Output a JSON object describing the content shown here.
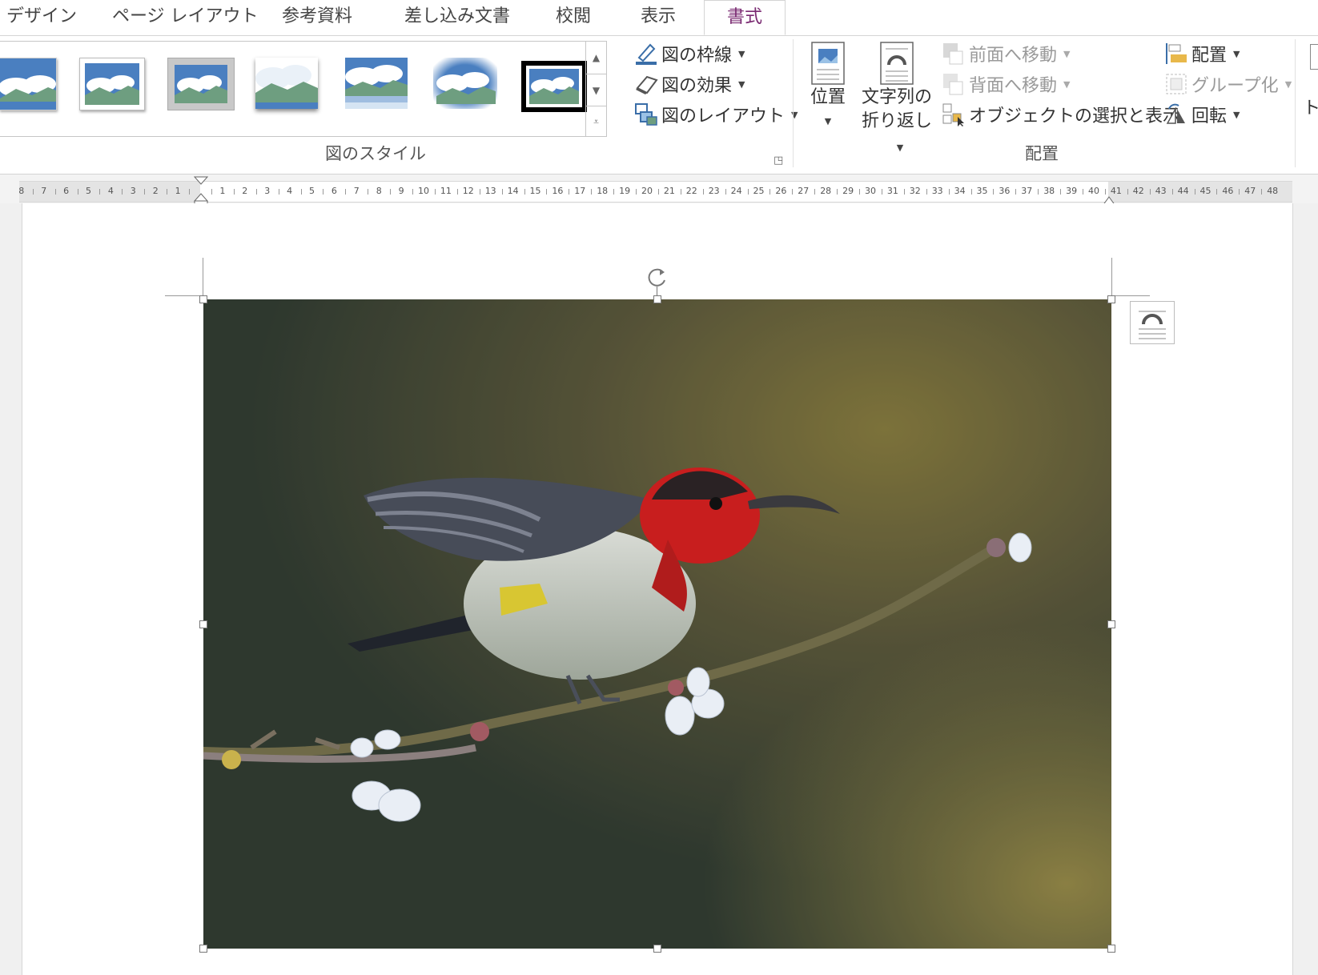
{
  "tabs": [
    {
      "label": "デザイン",
      "active": false
    },
    {
      "label": "ページ レイアウト",
      "active": false
    },
    {
      "label": "参考資料",
      "active": false
    },
    {
      "label": "差し込み文書",
      "active": false
    },
    {
      "label": "校閲",
      "active": false
    },
    {
      "label": "表示",
      "active": false
    },
    {
      "label": "書式",
      "active": true
    }
  ],
  "picture_styles": {
    "group_label": "図のスタイル",
    "border_label": "図の枠線",
    "effects_label": "図の効果",
    "layout_label": "図のレイアウト"
  },
  "arrange": {
    "group_label": "配置",
    "position_label": "位置",
    "wrap_text_line1": "文字列の",
    "wrap_text_line2": "折り返し",
    "bring_forward_label": "前面へ移動",
    "send_backward_label": "背面へ移動",
    "selection_pane_label": "オブジェクトの選択と表示",
    "align_label": "配置",
    "group_obj_label": "グループ化",
    "rotate_label": "回転"
  },
  "cut_off_label": "ト",
  "ruler": {
    "left_ticks": [
      "8",
      "7",
      "6",
      "5",
      "4",
      "3",
      "2",
      "1"
    ],
    "right_ticks": [
      "1",
      "2",
      "3",
      "4",
      "5",
      "6",
      "7",
      "8",
      "9",
      "10",
      "11",
      "12",
      "13",
      "14",
      "15",
      "16",
      "17",
      "18",
      "19",
      "20",
      "21",
      "22",
      "23",
      "24",
      "25",
      "26",
      "27",
      "28",
      "29",
      "30",
      "31",
      "32",
      "33",
      "34",
      "35",
      "36",
      "37",
      "38",
      "39",
      "40",
      "41",
      "42",
      "43",
      "44",
      "45",
      "46",
      "47",
      "48"
    ]
  },
  "icons": {
    "border": "pen-icon",
    "effects": "eraser-icon",
    "layout": "smartart-icon",
    "position": "position-icon",
    "wrap": "wrap-text-icon",
    "rotate": "rotate-icon",
    "rotate_handle": "rotate-handle-icon",
    "layout_options": "layout-options-icon"
  },
  "colors": {
    "active_tab": "#7a2a72",
    "thumb_blue": "#4a7fc0",
    "thumb_green": "#6e9e80"
  }
}
